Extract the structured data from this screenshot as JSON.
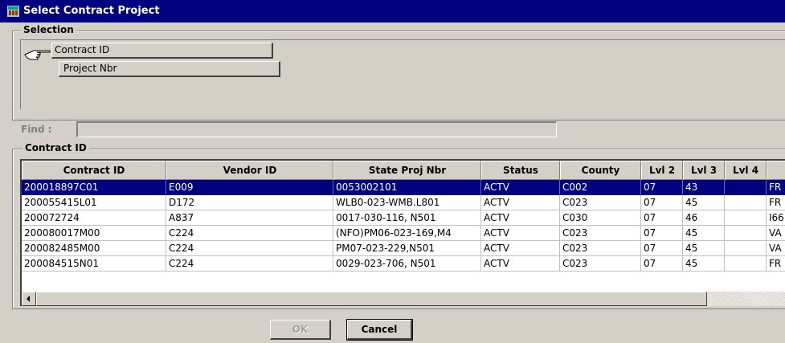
{
  "window": {
    "title": "Select Contract Project"
  },
  "selection": {
    "legend": "Selection",
    "options": [
      "Contract ID",
      "Project Nbr"
    ]
  },
  "find": {
    "label": "Find :",
    "value": ""
  },
  "list": {
    "legend": "Contract ID",
    "columns": [
      "Contract ID",
      "Vendor ID",
      "State Proj Nbr",
      "Status",
      "County",
      "Lvl 2",
      "Lvl 3",
      "Lvl 4",
      ""
    ],
    "rows": [
      [
        "200018897C01",
        "E009",
        "0053002101",
        "ACTV",
        "C002",
        "07",
        "43",
        "",
        "FR"
      ],
      [
        "200055415L01",
        "D172",
        "WLB0-023-WMB.L801",
        "ACTV",
        "C023",
        "07",
        "45",
        "",
        "FR"
      ],
      [
        "200072724",
        "A837",
        "0017-030-116, N501",
        "ACTV",
        "C030",
        "07",
        "46",
        "",
        "I66"
      ],
      [
        "200080017M00",
        "C224",
        "(NFO)PM06-023-169,M4",
        "ACTV",
        "C023",
        "07",
        "45",
        "",
        "VA"
      ],
      [
        "200082485M00",
        "C224",
        "PM07-023-229,N501",
        "ACTV",
        "C023",
        "07",
        "45",
        "",
        "VA"
      ],
      [
        "200084515N01",
        "C224",
        "0029-023-706, N501",
        "ACTV",
        "C023",
        "07",
        "45",
        "",
        "FR"
      ]
    ],
    "selected_row": 0
  },
  "buttons": {
    "ok": "OK",
    "cancel": "Cancel"
  },
  "colors": {
    "titlebar": "#000080",
    "selection_highlight": "#000080",
    "face": "#d4d0c8"
  }
}
